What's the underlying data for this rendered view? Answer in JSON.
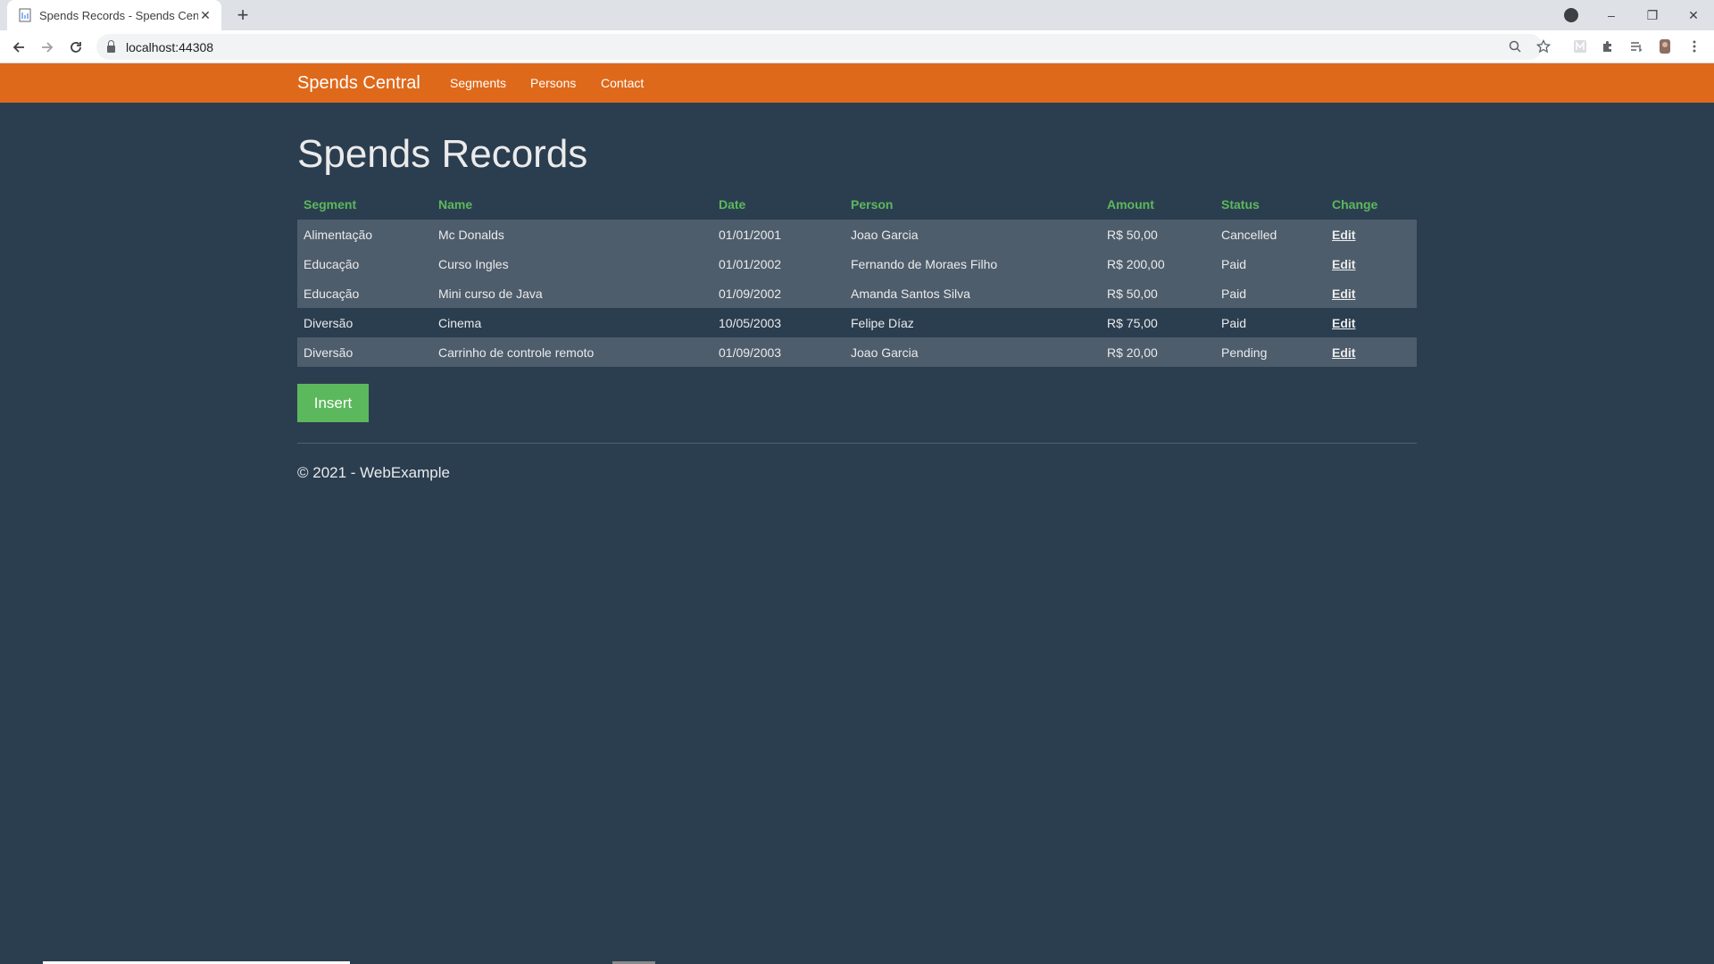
{
  "browser": {
    "tab_title": "Spends Records - Spends Central",
    "url": "localhost:44308",
    "new_tab": "+",
    "minimize": "–",
    "restore": "❐",
    "close": "✕"
  },
  "navbar": {
    "brand": "Spends Central",
    "links": [
      "Segments",
      "Persons",
      "Contact"
    ],
    "color": "#df691a"
  },
  "page": {
    "title": "Spends Records",
    "columns": [
      "Segment",
      "Name",
      "Date",
      "Person",
      "Amount",
      "Status",
      "Change"
    ],
    "rows": [
      {
        "segment": "Alimentação",
        "name": "Mc Donalds",
        "date": "01/01/2001",
        "person": "Joao Garcia",
        "amount": "R$ 50,00",
        "status": "Cancelled",
        "change": "Edit"
      },
      {
        "segment": "Educação",
        "name": "Curso Ingles",
        "date": "01/01/2002",
        "person": "Fernando de Moraes Filho",
        "amount": "R$ 200,00",
        "status": "Paid",
        "change": "Edit"
      },
      {
        "segment": "Educação",
        "name": "Mini curso de Java",
        "date": "01/09/2002",
        "person": "Amanda Santos Silva",
        "amount": "R$ 50,00",
        "status": "Paid",
        "change": "Edit"
      },
      {
        "segment": "Diversão",
        "name": "Cinema",
        "date": "10/05/2003",
        "person": "Felipe Díaz",
        "amount": "R$ 75,00",
        "status": "Paid",
        "change": "Edit"
      },
      {
        "segment": "Diversão",
        "name": "Carrinho de controle remoto",
        "date": "01/09/2003",
        "person": "Joao Garcia",
        "amount": "R$ 20,00",
        "status": "Pending",
        "change": "Edit"
      }
    ],
    "insert_label": "Insert",
    "footer": "© 2021 - WebExample"
  },
  "colors": {
    "background": "#2b3e50",
    "header_text": "#5cb85c",
    "stripe": "#4e5d6c",
    "button": "#5cb85c"
  }
}
